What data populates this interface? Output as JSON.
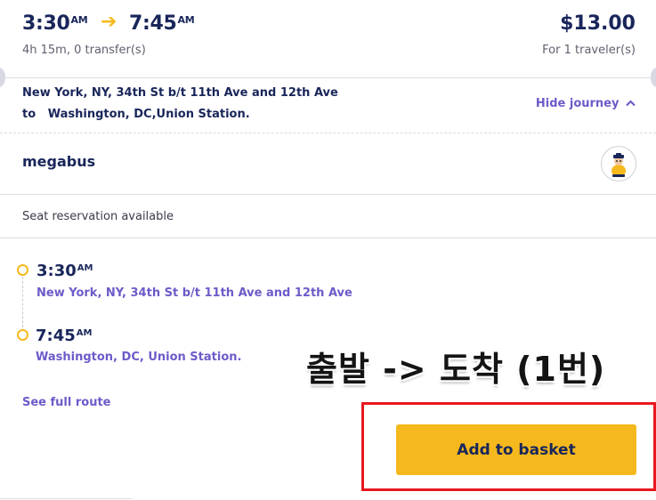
{
  "trip": {
    "departure_time": "3:30",
    "departure_ampm": "AM",
    "arrival_time": "7:45",
    "arrival_ampm": "AM",
    "duration": "4h 15m, 0 transfer(s)",
    "price": "$13.00",
    "travelers": "For 1 traveler(s)"
  },
  "route": {
    "from": "New York, NY, 34th St b/t 11th Ave and 12th Ave",
    "to_prefix": "to",
    "to": "Washington, DC,Union Station.",
    "hide_journey_label": "Hide journey"
  },
  "carrier": {
    "name": "megabus",
    "logo_icon": "megabus-mascot-icon"
  },
  "amenities": {
    "seat_reservation": "Seat reservation available"
  },
  "stops": [
    {
      "time": "3:30",
      "ampm": "AM",
      "name": "New York, NY, 34th St b/t 11th Ave and 12th Ave"
    },
    {
      "time": "7:45",
      "ampm": "AM",
      "name": "Washington, DC, Union Station."
    }
  ],
  "see_full_route": "See full route",
  "annotation": "출발 -> 도착 (1번)",
  "add_to_basket": "Add to basket",
  "colors": {
    "navy": "#19265a",
    "purple_link": "#6e5bc9",
    "accent_yellow": "#f5b91e",
    "highlight_red": "#e8181f"
  }
}
